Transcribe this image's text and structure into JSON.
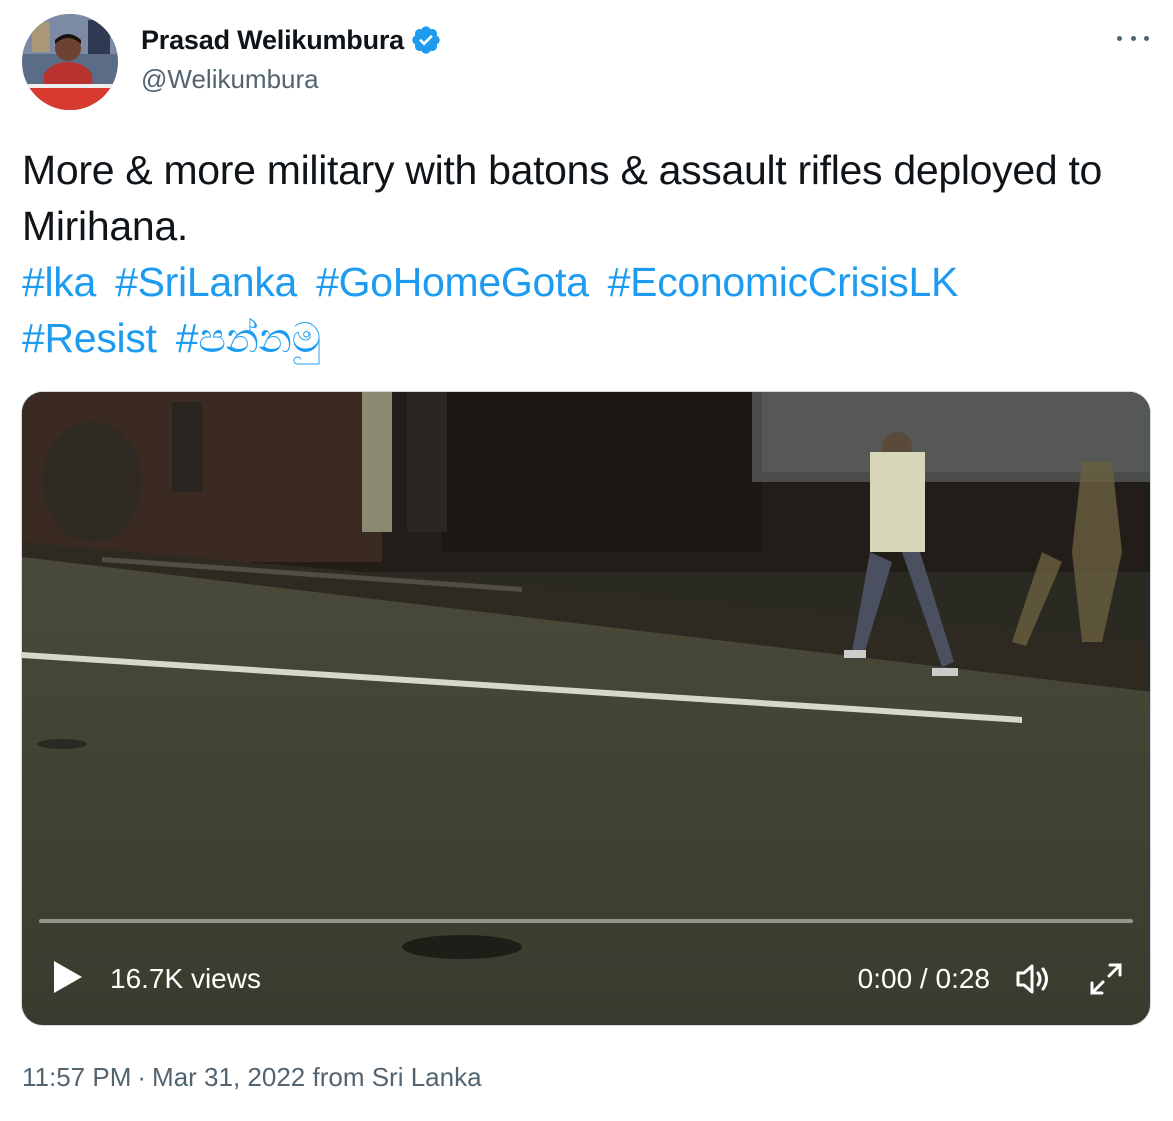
{
  "author": {
    "display_name": "Prasad Welikumbura",
    "handle": "@Welikumbura",
    "verified": true
  },
  "tweet": {
    "text": "More & more military with batons & assault rifles deployed to Mirihana.",
    "hashtags": [
      "#lka",
      "#SriLanka",
      "#GoHomeGota",
      "#EconomicCrisisLK",
      "#Resist",
      "#පන්නමු"
    ]
  },
  "video": {
    "views": "16.7K views",
    "time": "0:00 / 0:28",
    "progress": 0
  },
  "meta": {
    "time": "11:57 PM",
    "separator": "·",
    "date": "Mar 31, 2022",
    "location": "from Sri Lanka"
  },
  "colors": {
    "link": "#1d9bf0",
    "secondary_text": "#536471",
    "verified_badge": "#1d9bf0"
  },
  "icons": {
    "verified": "verified-badge-icon",
    "more": "more-options-icon",
    "play": "play-icon",
    "volume": "volume-icon",
    "fullscreen": "fullscreen-icon"
  }
}
